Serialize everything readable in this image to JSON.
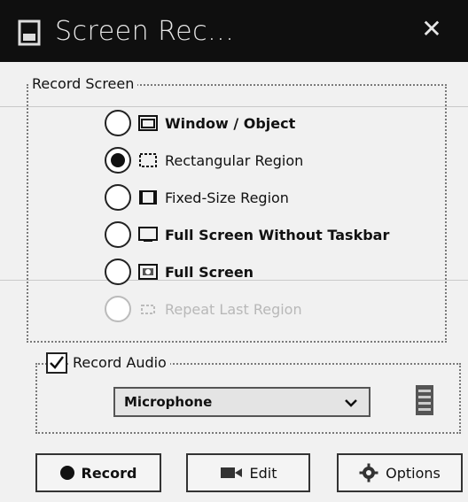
{
  "window": {
    "title": "Screen Rec..."
  },
  "record_screen": {
    "legend": "Record Screen",
    "options": [
      {
        "label": "Window / Object",
        "icon": "window-icon",
        "checked": false,
        "enabled": true
      },
      {
        "label": "Rectangular Region",
        "icon": "rectangle-region-icon",
        "checked": true,
        "enabled": true
      },
      {
        "label": "Fixed-Size Region",
        "icon": "fixed-size-region-icon",
        "checked": false,
        "enabled": true
      },
      {
        "label": "Full Screen Without Taskbar",
        "icon": "monitor-icon",
        "checked": false,
        "enabled": true
      },
      {
        "label": "Full Screen",
        "icon": "fullscreen-icon",
        "checked": false,
        "enabled": true
      },
      {
        "label": "Repeat Last Region",
        "icon": "repeat-region-icon",
        "checked": false,
        "enabled": false
      }
    ]
  },
  "audio": {
    "checkbox_label": "Record Audio",
    "checked": true,
    "device": "Microphone"
  },
  "buttons": {
    "record": "Record",
    "edit": "Edit",
    "options": "Options"
  }
}
